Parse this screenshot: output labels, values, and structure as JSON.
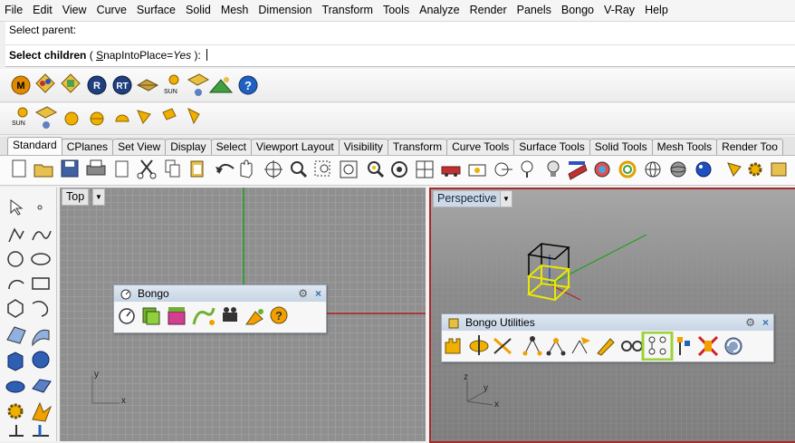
{
  "menu": [
    "File",
    "Edit",
    "View",
    "Curve",
    "Surface",
    "Solid",
    "Mesh",
    "Dimension",
    "Transform",
    "Tools",
    "Analyze",
    "Render",
    "Panels",
    "Bongo",
    "V-Ray",
    "Help"
  ],
  "command": {
    "history": "Select parent:",
    "prompt_bold": "Select children",
    "option_prefix": "( ",
    "option_hotkey": "S",
    "option_rest": "napIntoPlace",
    "option_eq": "=",
    "option_value": "Yes",
    "prompt_end": " ):"
  },
  "render_toolbar_icons": [
    "maxwell-icon",
    "material-icon",
    "texture-icon",
    "render-r-icon",
    "render-rt-icon",
    "ground-plane-icon",
    "sun-icon",
    "light-icon",
    "environment-icon",
    "help-icon"
  ],
  "sun_label": "SUN",
  "tabs": [
    "Standard",
    "CPlanes",
    "Set View",
    "Display",
    "Select",
    "Viewport Layout",
    "Visibility",
    "Transform",
    "Curve Tools",
    "Surface Tools",
    "Solid Tools",
    "Mesh Tools",
    "Render Too"
  ],
  "active_tab": "Standard",
  "viewports": {
    "top": {
      "label": "Top",
      "axis_x": "x",
      "axis_y": "y"
    },
    "perspective": {
      "label": "Perspective",
      "axis_x": "x",
      "axis_y": "y",
      "axis_z": "z"
    }
  },
  "floating": {
    "bongo": {
      "title": "Bongo"
    },
    "bongo_utilities": {
      "title": "Bongo Utilities",
      "selected_tool": "select-children-icon"
    }
  },
  "colors": {
    "perspective_border": "#a52a2a",
    "selection_yellow": "#e8e800",
    "x_axis": "#b02020",
    "y_axis": "#20a020",
    "highlight": "#9bd334"
  }
}
